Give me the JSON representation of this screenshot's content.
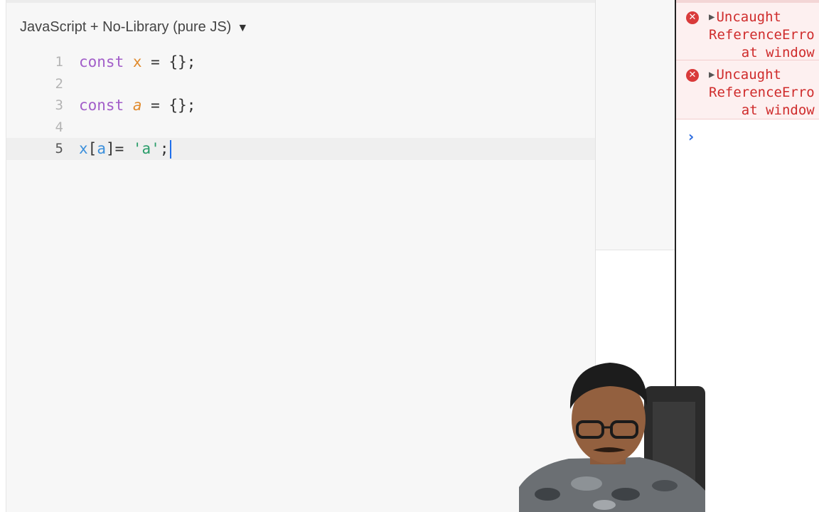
{
  "editor": {
    "language_label": "JavaScript + No-Library (pure JS)",
    "lines": [
      {
        "num": "1",
        "tokens": [
          [
            "kw",
            "const"
          ],
          [
            "punc",
            " "
          ],
          [
            "var",
            "x"
          ],
          [
            "punc",
            " = {};"
          ]
        ]
      },
      {
        "num": "2",
        "tokens": []
      },
      {
        "num": "3",
        "tokens": [
          [
            "kw",
            "const"
          ],
          [
            "punc",
            " "
          ],
          [
            "var ital",
            "a"
          ],
          [
            "punc",
            " = {};"
          ]
        ]
      },
      {
        "num": "4",
        "tokens": []
      },
      {
        "num": "5",
        "tokens": [
          [
            "ident",
            "x"
          ],
          [
            "punc",
            "["
          ],
          [
            "ident",
            "a"
          ],
          [
            "punc",
            "]= "
          ],
          [
            "str",
            "'a'"
          ],
          [
            "punc",
            ";"
          ]
        ]
      }
    ],
    "active_line": "5"
  },
  "console": {
    "errors": [
      {
        "line1": "Uncaught",
        "line2": "ReferenceErro",
        "line3": "    at window"
      },
      {
        "line1": "Uncaught",
        "line2": "ReferenceErro",
        "line3": "    at window"
      }
    ],
    "prompt_symbol": "›"
  },
  "colors": {
    "keyword": "#a25ec9",
    "variable": "#e08a2c",
    "identifier": "#3b8fdb",
    "string": "#2a9d6a",
    "error": "#cf2b2b"
  }
}
